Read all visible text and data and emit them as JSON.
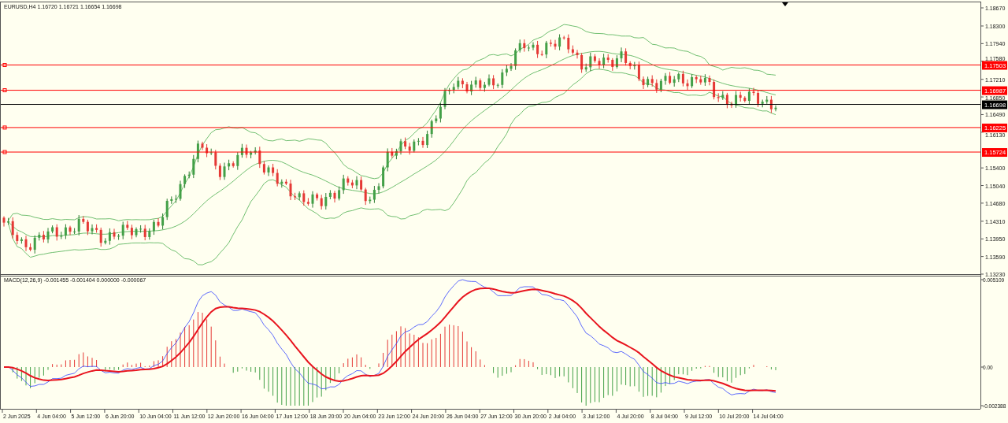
{
  "price_pane": {
    "title": "EURUSD,H4 1.16720 1.16721 1.16654 1.16698",
    "price_axis": [
      "1.18670",
      "1.18300",
      "1.17940",
      "1.17580",
      "1.17210",
      "1.16850",
      "1.16490",
      "1.16130",
      "1.15400",
      "1.15040",
      "1.14680",
      "1.14310",
      "1.13950",
      "1.13590",
      "1.13230"
    ],
    "levels": [
      {
        "kind": "level",
        "label": "1.17503",
        "color": "#ff0000"
      },
      {
        "kind": "level",
        "label": "1.16987",
        "color": "#ff0000"
      },
      {
        "kind": "current",
        "label": "1.16698",
        "color": "#000000"
      },
      {
        "kind": "level",
        "label": "1.16225",
        "color": "#ff0000"
      },
      {
        "kind": "level",
        "label": "1.15724",
        "color": "#ff0000"
      }
    ]
  },
  "macd_pane": {
    "title": "MACD(12,26,9) -0.001455 -0.001404 0.000000 -0.000067",
    "axis": [
      "0.005109",
      "0.00",
      "-0.002388"
    ]
  },
  "time_axis": [
    "2 Jun 2025",
    "4 Jun 04:00",
    "5 Jun 12:00",
    "6 Jun 20:00",
    "10 Jun 04:00",
    "11 Jun 12:00",
    "12 Jun 20:00",
    "16 Jun 04:00",
    "17 Jun 12:00",
    "18 Jun 20:00",
    "20 Jun 04:00",
    "23 Jun 12:00",
    "24 Jun 20:00",
    "26 Jun 04:00",
    "27 Jun 12:00",
    "30 Jun 20:00",
    "2 Jul 04:00",
    "3 Jul 12:00",
    "4 Jul 20:00",
    "8 Jul 04:00",
    "9 Jul 12:00",
    "10 Jul 20:00",
    "14 Jul 04:00"
  ]
}
